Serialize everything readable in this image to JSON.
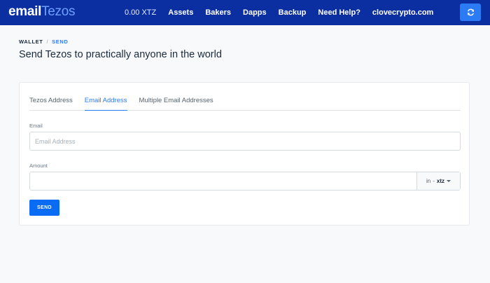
{
  "header": {
    "logo_part1": "email",
    "logo_part2": "Tezos",
    "balance": "0.00 XTZ",
    "nav": [
      "Assets",
      "Bakers",
      "Dapps",
      "Backup",
      "Need Help?",
      "clovecrypto.com"
    ],
    "refresh_icon": "refresh-icon"
  },
  "breadcrumb": {
    "wallet": "WALLET",
    "separator": "/",
    "current": "SEND"
  },
  "page_title": "Send Tezos to practically anyone in the world",
  "form": {
    "tabs": [
      {
        "label": "Tezos Address",
        "active": false
      },
      {
        "label": "Email Address",
        "active": true
      },
      {
        "label": "Multiple Email Addresses",
        "active": false
      }
    ],
    "email_label": "Email",
    "email_placeholder": "Email Address",
    "email_value": "",
    "amount_label": "Amount",
    "amount_value": "",
    "unit_prefix": "in",
    "unit_dash": "-",
    "unit_value": "xtz",
    "send_label": "SEND"
  },
  "colors": {
    "header_bg": "#0b2fa1",
    "accent": "#2b7bf5",
    "send_button": "#0a6cf5"
  }
}
